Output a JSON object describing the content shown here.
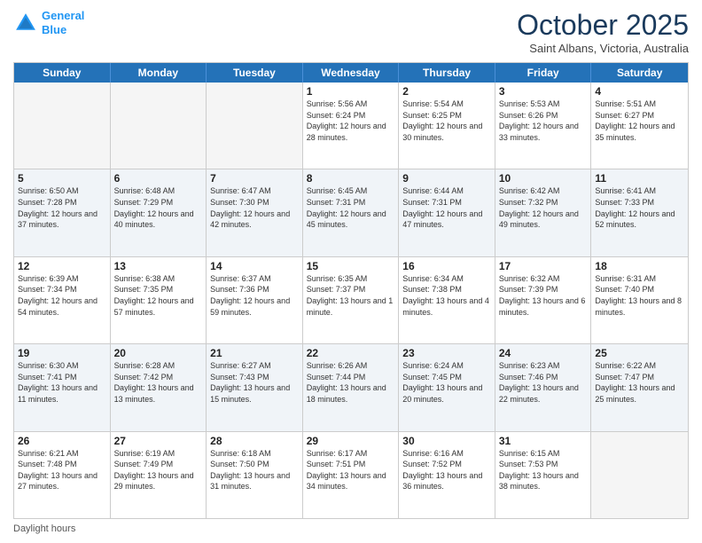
{
  "header": {
    "logo_line1": "General",
    "logo_line2": "Blue",
    "month": "October 2025",
    "location": "Saint Albans, Victoria, Australia"
  },
  "day_headers": [
    "Sunday",
    "Monday",
    "Tuesday",
    "Wednesday",
    "Thursday",
    "Friday",
    "Saturday"
  ],
  "weeks": [
    [
      {
        "num": "",
        "info": ""
      },
      {
        "num": "",
        "info": ""
      },
      {
        "num": "",
        "info": ""
      },
      {
        "num": "1",
        "info": "Sunrise: 5:56 AM\nSunset: 6:24 PM\nDaylight: 12 hours\nand 28 minutes."
      },
      {
        "num": "2",
        "info": "Sunrise: 5:54 AM\nSunset: 6:25 PM\nDaylight: 12 hours\nand 30 minutes."
      },
      {
        "num": "3",
        "info": "Sunrise: 5:53 AM\nSunset: 6:26 PM\nDaylight: 12 hours\nand 33 minutes."
      },
      {
        "num": "4",
        "info": "Sunrise: 5:51 AM\nSunset: 6:27 PM\nDaylight: 12 hours\nand 35 minutes."
      }
    ],
    [
      {
        "num": "5",
        "info": "Sunrise: 6:50 AM\nSunset: 7:28 PM\nDaylight: 12 hours\nand 37 minutes."
      },
      {
        "num": "6",
        "info": "Sunrise: 6:48 AM\nSunset: 7:29 PM\nDaylight: 12 hours\nand 40 minutes."
      },
      {
        "num": "7",
        "info": "Sunrise: 6:47 AM\nSunset: 7:30 PM\nDaylight: 12 hours\nand 42 minutes."
      },
      {
        "num": "8",
        "info": "Sunrise: 6:45 AM\nSunset: 7:31 PM\nDaylight: 12 hours\nand 45 minutes."
      },
      {
        "num": "9",
        "info": "Sunrise: 6:44 AM\nSunset: 7:31 PM\nDaylight: 12 hours\nand 47 minutes."
      },
      {
        "num": "10",
        "info": "Sunrise: 6:42 AM\nSunset: 7:32 PM\nDaylight: 12 hours\nand 49 minutes."
      },
      {
        "num": "11",
        "info": "Sunrise: 6:41 AM\nSunset: 7:33 PM\nDaylight: 12 hours\nand 52 minutes."
      }
    ],
    [
      {
        "num": "12",
        "info": "Sunrise: 6:39 AM\nSunset: 7:34 PM\nDaylight: 12 hours\nand 54 minutes."
      },
      {
        "num": "13",
        "info": "Sunrise: 6:38 AM\nSunset: 7:35 PM\nDaylight: 12 hours\nand 57 minutes."
      },
      {
        "num": "14",
        "info": "Sunrise: 6:37 AM\nSunset: 7:36 PM\nDaylight: 12 hours\nand 59 minutes."
      },
      {
        "num": "15",
        "info": "Sunrise: 6:35 AM\nSunset: 7:37 PM\nDaylight: 13 hours\nand 1 minute."
      },
      {
        "num": "16",
        "info": "Sunrise: 6:34 AM\nSunset: 7:38 PM\nDaylight: 13 hours\nand 4 minutes."
      },
      {
        "num": "17",
        "info": "Sunrise: 6:32 AM\nSunset: 7:39 PM\nDaylight: 13 hours\nand 6 minutes."
      },
      {
        "num": "18",
        "info": "Sunrise: 6:31 AM\nSunset: 7:40 PM\nDaylight: 13 hours\nand 8 minutes."
      }
    ],
    [
      {
        "num": "19",
        "info": "Sunrise: 6:30 AM\nSunset: 7:41 PM\nDaylight: 13 hours\nand 11 minutes."
      },
      {
        "num": "20",
        "info": "Sunrise: 6:28 AM\nSunset: 7:42 PM\nDaylight: 13 hours\nand 13 minutes."
      },
      {
        "num": "21",
        "info": "Sunrise: 6:27 AM\nSunset: 7:43 PM\nDaylight: 13 hours\nand 15 minutes."
      },
      {
        "num": "22",
        "info": "Sunrise: 6:26 AM\nSunset: 7:44 PM\nDaylight: 13 hours\nand 18 minutes."
      },
      {
        "num": "23",
        "info": "Sunrise: 6:24 AM\nSunset: 7:45 PM\nDaylight: 13 hours\nand 20 minutes."
      },
      {
        "num": "24",
        "info": "Sunrise: 6:23 AM\nSunset: 7:46 PM\nDaylight: 13 hours\nand 22 minutes."
      },
      {
        "num": "25",
        "info": "Sunrise: 6:22 AM\nSunset: 7:47 PM\nDaylight: 13 hours\nand 25 minutes."
      }
    ],
    [
      {
        "num": "26",
        "info": "Sunrise: 6:21 AM\nSunset: 7:48 PM\nDaylight: 13 hours\nand 27 minutes."
      },
      {
        "num": "27",
        "info": "Sunrise: 6:19 AM\nSunset: 7:49 PM\nDaylight: 13 hours\nand 29 minutes."
      },
      {
        "num": "28",
        "info": "Sunrise: 6:18 AM\nSunset: 7:50 PM\nDaylight: 13 hours\nand 31 minutes."
      },
      {
        "num": "29",
        "info": "Sunrise: 6:17 AM\nSunset: 7:51 PM\nDaylight: 13 hours\nand 34 minutes."
      },
      {
        "num": "30",
        "info": "Sunrise: 6:16 AM\nSunset: 7:52 PM\nDaylight: 13 hours\nand 36 minutes."
      },
      {
        "num": "31",
        "info": "Sunrise: 6:15 AM\nSunset: 7:53 PM\nDaylight: 13 hours\nand 38 minutes."
      },
      {
        "num": "",
        "info": ""
      }
    ]
  ],
  "footer": {
    "daylight_label": "Daylight hours"
  }
}
